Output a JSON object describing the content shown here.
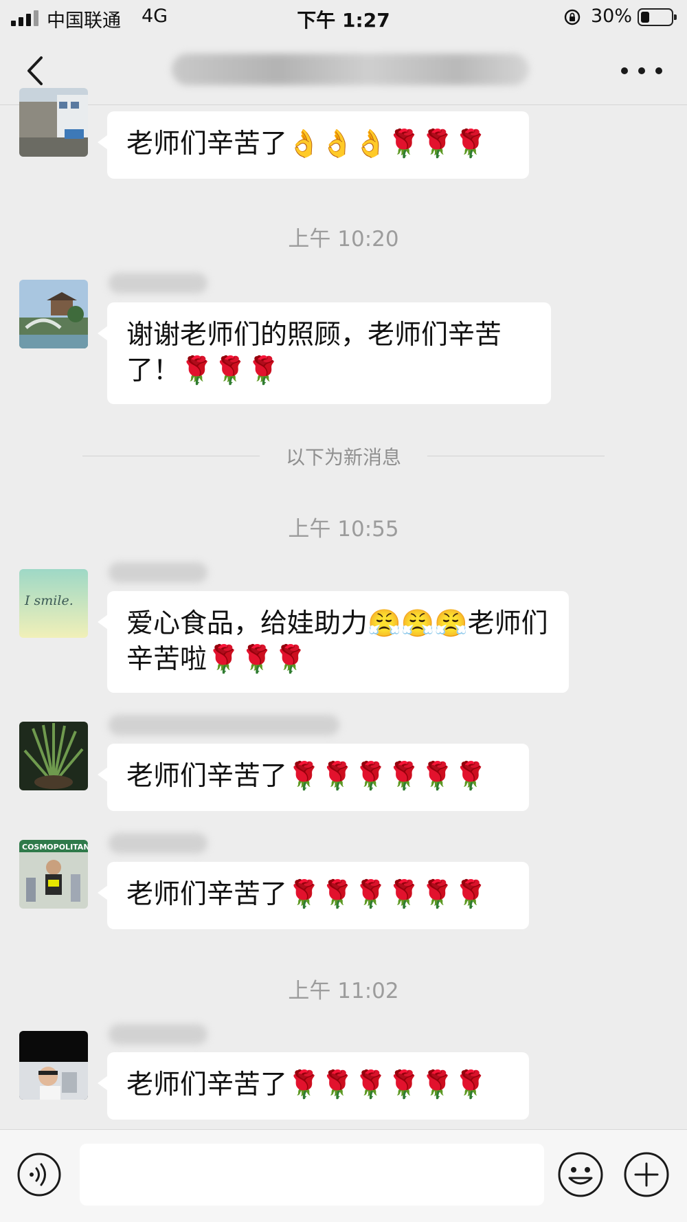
{
  "status_bar": {
    "carrier": "中国联通",
    "network": "4G",
    "time": "下午 1:27",
    "battery": "30%",
    "battery_level": 0.3
  },
  "nav": {
    "title": "",
    "back_icon": "chevron-left-icon",
    "more_icon": "more-dots-icon"
  },
  "messages": [
    {
      "sender": "",
      "text": "老师们辛苦了👌👌👌🌹🌹🌹"
    },
    {
      "sender": "",
      "text": "谢谢老师们的照顾，老师们辛苦了！🌹🌹🌹"
    },
    {
      "sender": "",
      "text": "爱心食品，给娃助力😤😤😤老师们辛苦啦🌹🌹🌹"
    },
    {
      "sender": "",
      "text": "老师们辛苦了🌹🌹🌹🌹🌹🌹"
    },
    {
      "sender": "",
      "text": "老师们辛苦了🌹🌹🌹🌹🌹🌹"
    },
    {
      "sender": "",
      "text": "老师们辛苦了🌹🌹🌹🌹🌹🌹"
    }
  ],
  "timestamps": [
    "上午 10:20",
    "上午 10:55",
    "上午 11:02"
  ],
  "new_messages_divider": "以下为新消息",
  "avatar_texts": {
    "smile": "I smile.",
    "cosmo": "COSMOPOLITAN"
  },
  "input": {
    "placeholder": "",
    "value": ""
  },
  "colors": {
    "background": "#ededed",
    "bubble": "#ffffff",
    "timestamp": "#9c9c9c"
  }
}
